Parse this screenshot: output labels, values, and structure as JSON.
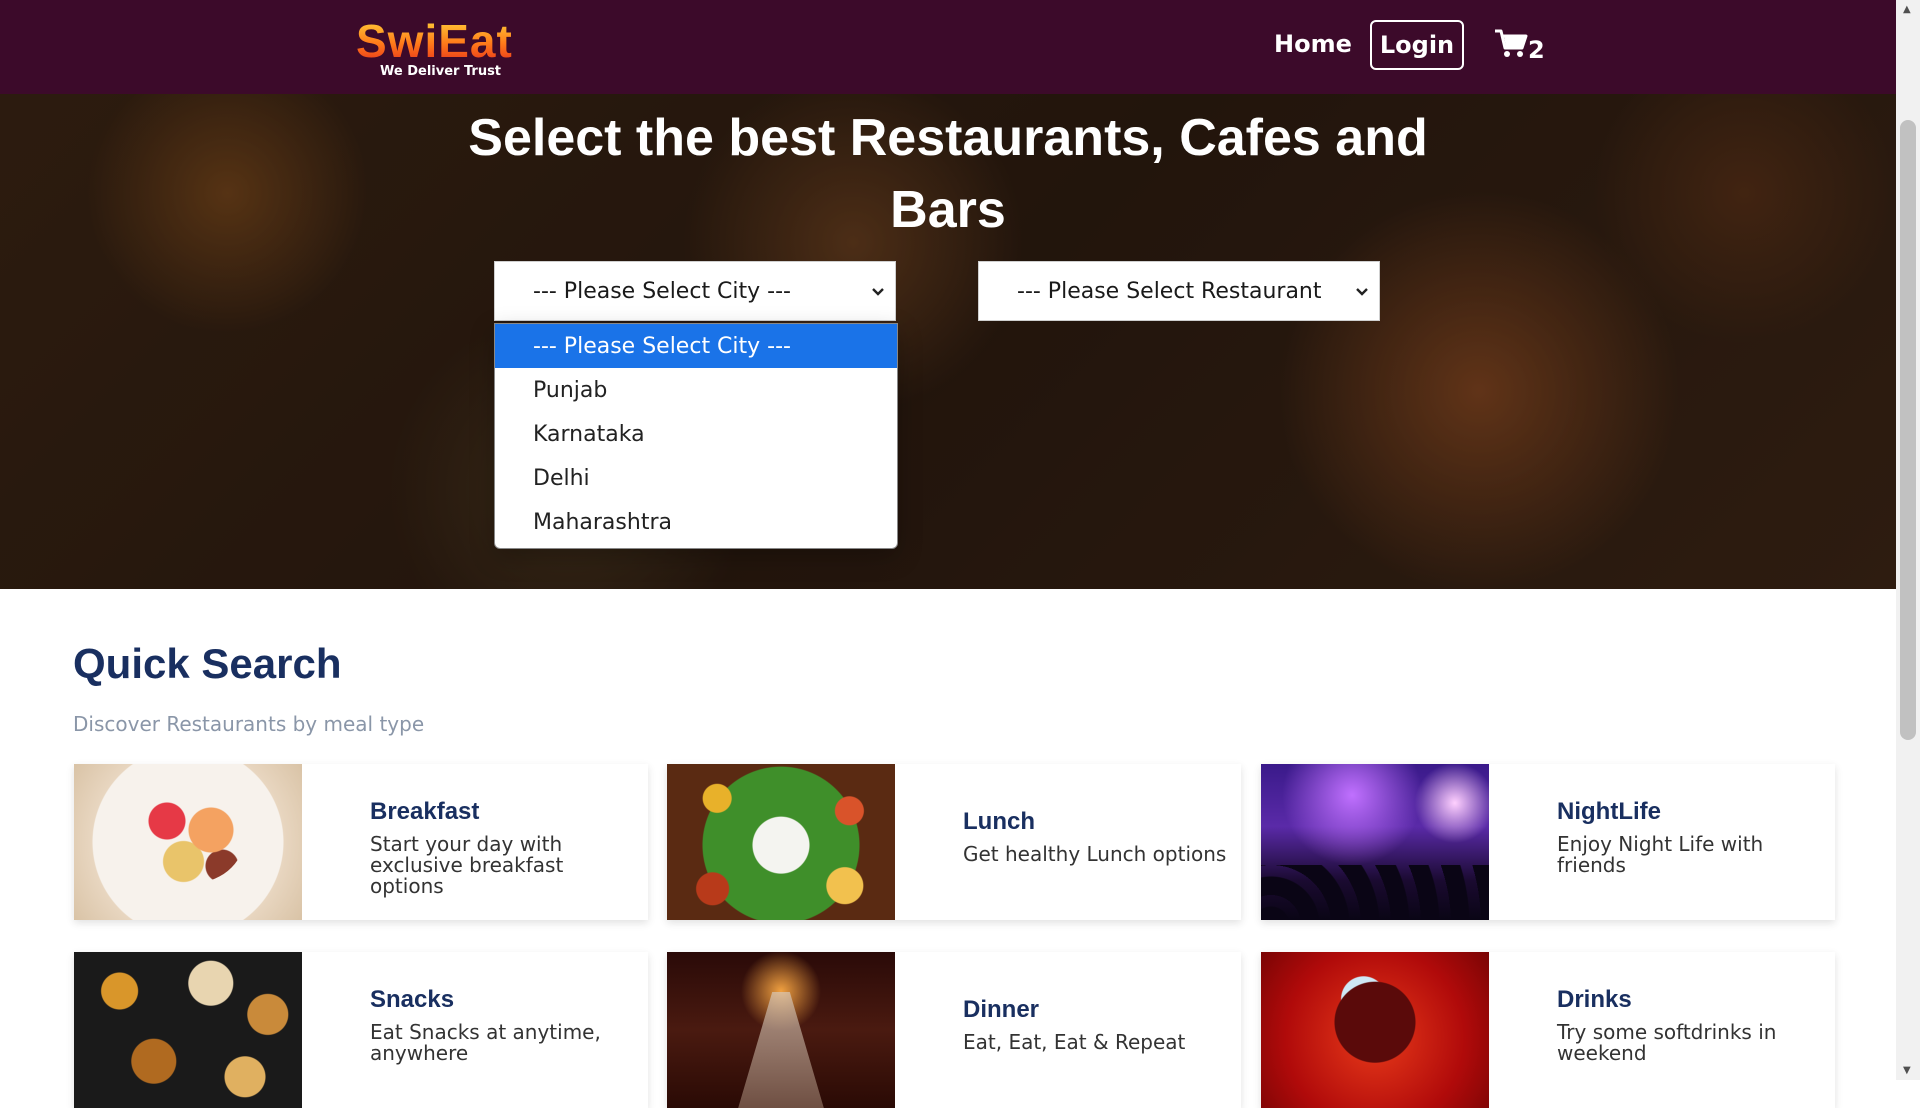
{
  "navbar": {
    "logo_text": "SwiEat",
    "logo_tagline": "We Deliver Trust",
    "home_label": "Home",
    "login_label": "Login",
    "cart_icon": "cart-icon",
    "cart_count": "2",
    "bg_color": "#3c0a2a"
  },
  "hero": {
    "title_line1": "Select the best Restaurants, Cafes and",
    "title_line2": "Bars",
    "city_select": {
      "value": "--- Please Select City ---",
      "options": [
        "--- Please Select City ---",
        "Punjab",
        "Karnataka",
        "Delhi",
        "Maharashtra"
      ]
    },
    "restaurant_select": {
      "value": "--- Please Select Restaurant"
    }
  },
  "quick_search": {
    "title": "Quick Search",
    "subtitle": "Discover Restaurants by meal type",
    "cards": [
      {
        "title": "Breakfast",
        "description": "Start your day with exclusive breakfast options"
      },
      {
        "title": "Lunch",
        "description": "Get healthy Lunch options"
      },
      {
        "title": "NightLife",
        "description": "Enjoy Night Life with friends"
      },
      {
        "title": "Snacks",
        "description": "Eat Snacks at anytime, anywhere"
      },
      {
        "title": "Dinner",
        "description": "Eat, Eat, Eat & Repeat"
      },
      {
        "title": "Drinks",
        "description": "Try some softdrinks in weekend"
      }
    ]
  },
  "colors": {
    "accent_blue": "#1a73e8",
    "heading_navy": "#192f60"
  }
}
